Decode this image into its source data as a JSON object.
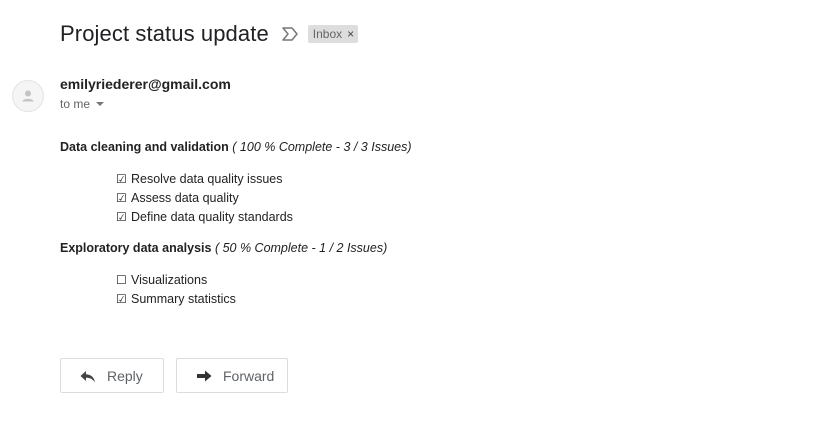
{
  "message": {
    "subject": "Project status update",
    "label": "Inbox",
    "label_close": "×",
    "sender": "emilyriederer@gmail.com",
    "recipient": "to me"
  },
  "sections": [
    {
      "title": "Data cleaning and validation",
      "progress": "( 100 % Complete - 3 / 3 Issues)",
      "tasks": [
        {
          "checkbox": "☑",
          "label": "Resolve data quality issues",
          "done": true
        },
        {
          "checkbox": "☑",
          "label": "Assess data quality",
          "done": true
        },
        {
          "checkbox": "☑",
          "label": "Define data quality standards",
          "done": true
        }
      ]
    },
    {
      "title": "Exploratory data analysis",
      "progress": "( 50 % Complete - 1 / 2 Issues)",
      "tasks": [
        {
          "checkbox": "☐",
          "label": "Visualizations",
          "done": false
        },
        {
          "checkbox": "☑",
          "label": "Summary statistics",
          "done": true
        }
      ]
    }
  ],
  "actions": {
    "reply_label": "Reply",
    "forward_label": "Forward"
  },
  "icons": {
    "important": "important-marker-icon",
    "avatar": "person-icon",
    "dropdown": "caret-down-icon",
    "reply": "reply-arrow-icon",
    "forward": "forward-arrow-icon"
  }
}
